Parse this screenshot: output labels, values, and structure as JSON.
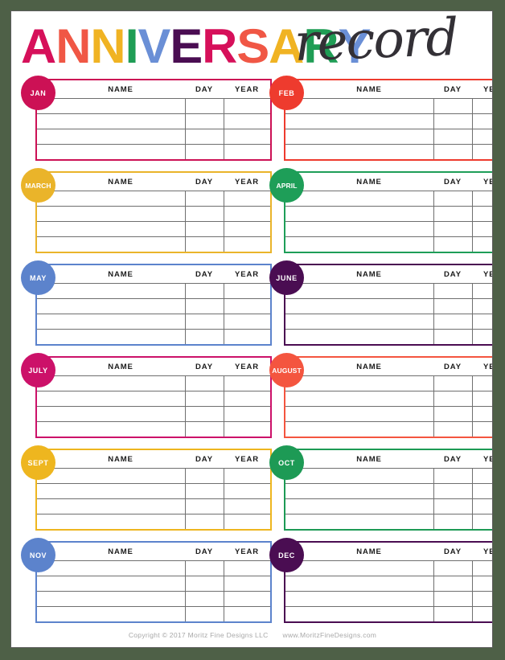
{
  "page": {
    "background_color": "#4e6047",
    "sheet_color": "#ffffff",
    "frame_color": "#5d5d5d"
  },
  "title": {
    "word": "ANNIVERSARY",
    "script": "record",
    "script_color": "#333036",
    "letters": [
      {
        "char": "A",
        "color": "#d6105a"
      },
      {
        "char": "N",
        "color": "#f05745"
      },
      {
        "char": "N",
        "color": "#f0b323"
      },
      {
        "char": "I",
        "color": "#1f9d55"
      },
      {
        "char": "V",
        "color": "#6a8fd6"
      },
      {
        "char": "E",
        "color": "#4a0d52"
      },
      {
        "char": "R",
        "color": "#d6105a"
      },
      {
        "char": "S",
        "color": "#f05745"
      },
      {
        "char": "A",
        "color": "#f0b323"
      },
      {
        "char": "R",
        "color": "#1f9d55"
      },
      {
        "char": "Y",
        "color": "#6a8fd6"
      }
    ]
  },
  "columns": {
    "name": "NAME",
    "day": "DAY",
    "year": "YEAR"
  },
  "rows_per_month": 4,
  "months": [
    {
      "label": "JAN",
      "color": "#cc1155",
      "badge_color": "#cc1155"
    },
    {
      "label": "FEB",
      "color": "#ee3b2e",
      "badge_color": "#ee3b2e"
    },
    {
      "label": "MARCH",
      "color": "#eab42a",
      "badge_color": "#eab42a"
    },
    {
      "label": "APRIL",
      "color": "#1e9e58",
      "badge_color": "#1e9e58"
    },
    {
      "label": "MAY",
      "color": "#5c83cc",
      "badge_color": "#5c83cc"
    },
    {
      "label": "JUNE",
      "color": "#4a0d52",
      "badge_color": "#4a0d52"
    },
    {
      "label": "JULY",
      "color": "#cc1169",
      "badge_color": "#cc1169"
    },
    {
      "label": "AUGUST",
      "color": "#f4553f",
      "badge_color": "#f4553f"
    },
    {
      "label": "SEPT",
      "color": "#eeb61f",
      "badge_color": "#eeb61f"
    },
    {
      "label": "OCT",
      "color": "#1d9a55",
      "badge_color": "#1d9a55"
    },
    {
      "label": "NOV",
      "color": "#5c83cc",
      "badge_color": "#5c83cc"
    },
    {
      "label": "DEC",
      "color": "#4a0d52",
      "badge_color": "#4a0d52"
    }
  ],
  "footer": {
    "copyright": "Copyright © 2017 Moritz Fine Designs LLC",
    "website": "www.MoritzFineDesigns.com"
  }
}
